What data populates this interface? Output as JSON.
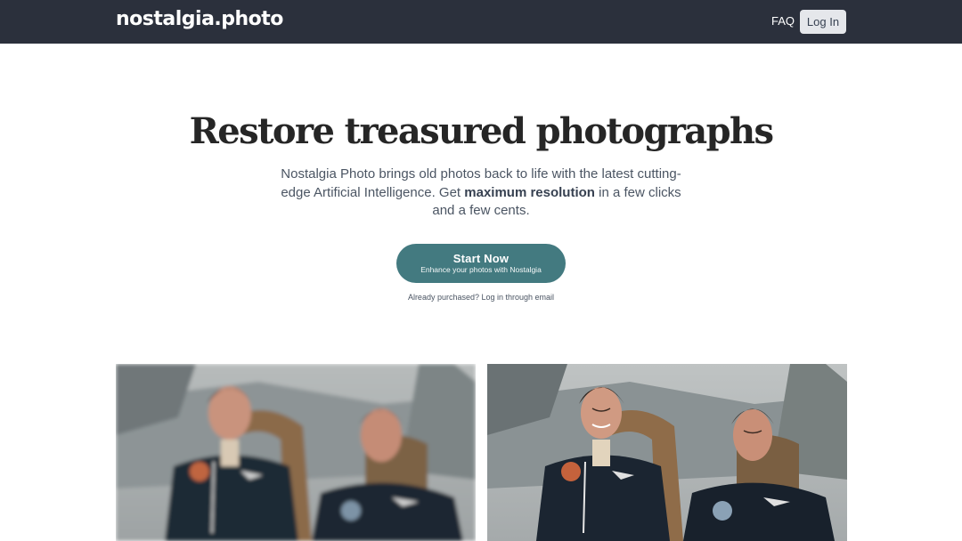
{
  "header": {
    "brand": "nostalgia.photo",
    "faq_label": "FAQ",
    "login_label": "Log In",
    "background": "#2b303c"
  },
  "hero": {
    "title": "Restore treasured photographs",
    "subtitle_part1": "Nostalgia Photo brings old photos back to life with the latest cutting-edge Artificial Intelligence. Get ",
    "subtitle_bold": "maximum resolution",
    "subtitle_part2": " in a few clicks and a few cents.",
    "cta_main": "Start Now",
    "cta_sub": "Enhance your photos with Nostalgia",
    "cta_color": "#437a80",
    "login_note_prefix": "Already purchased? ",
    "login_note_link": "Log in through email"
  },
  "gallery": {
    "before_icon": "blurry-photo-two-pilots",
    "after_icon": "restored-photo-two-pilots"
  }
}
